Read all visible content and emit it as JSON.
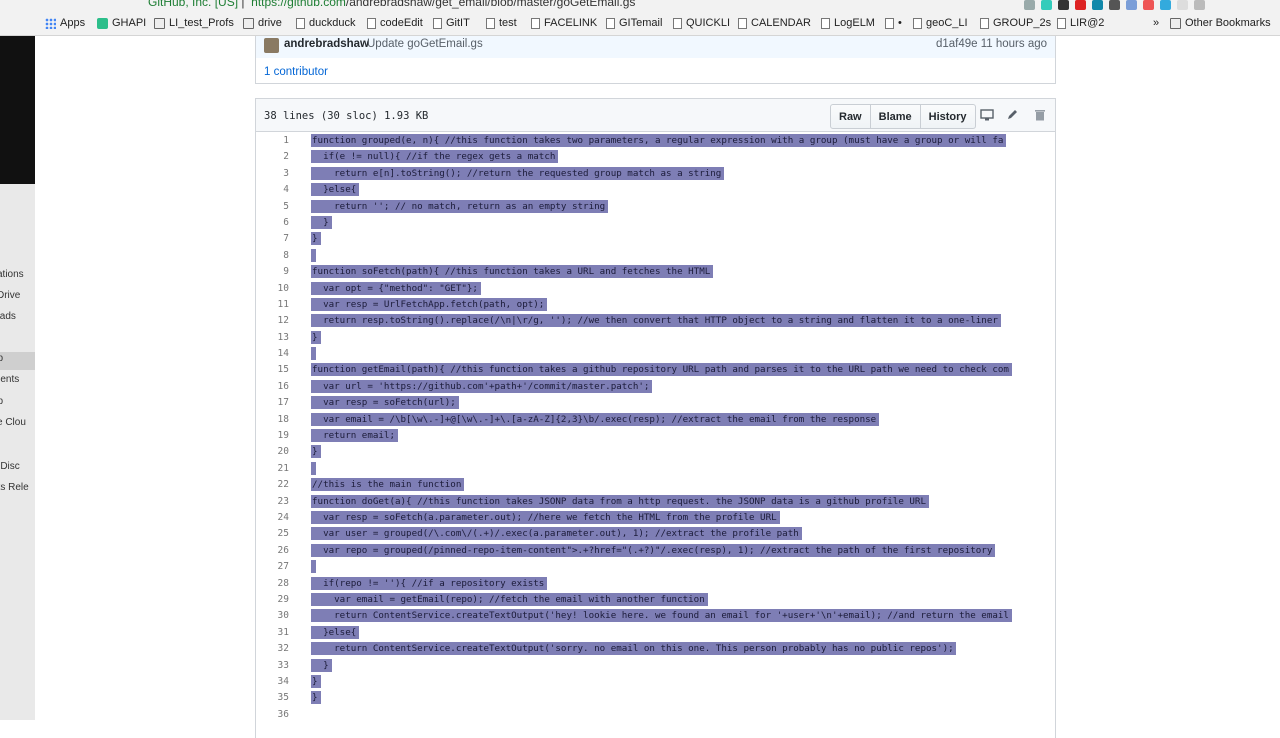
{
  "browser": {
    "url_secure": "GitHub, Inc. [US]",
    "url_host": "https://github.com",
    "url_path": "/andrebradshaw/get_email/blob/master/goGetEmail.gs"
  },
  "bookmarks": [
    {
      "label": "Apps",
      "icon": "apps-grid-icon"
    },
    {
      "label": "GHAPI",
      "icon": "ghapi-icon"
    },
    {
      "label": "LI_test_Profs",
      "icon": "folder-icon"
    },
    {
      "label": "drive",
      "icon": "folder-icon"
    },
    {
      "label": "duckduck",
      "icon": "page-icon"
    },
    {
      "label": "codeEdit",
      "icon": "page-icon"
    },
    {
      "label": "GitIT",
      "icon": "page-icon"
    },
    {
      "label": "test",
      "icon": "page-icon"
    },
    {
      "label": "FACELINK",
      "icon": "page-icon"
    },
    {
      "label": "GITemail",
      "icon": "page-icon"
    },
    {
      "label": "QUICKLI",
      "icon": "page-icon"
    },
    {
      "label": "CALENDAR",
      "icon": "page-icon"
    },
    {
      "label": "LogELM",
      "icon": "page-icon"
    },
    {
      "label": "•",
      "icon": "page-icon"
    },
    {
      "label": "geoC_LI",
      "icon": "page-icon"
    },
    {
      "label": "GROUP_2s",
      "icon": "page-icon"
    },
    {
      "label": "LIR@2",
      "icon": "page-icon"
    },
    {
      "label": "»",
      "icon": ""
    },
    {
      "label": "Other Bookmarks",
      "icon": "folder-icon"
    }
  ],
  "left_window": {
    "items": [
      "cations",
      "l Drive",
      "loads",
      "ts",
      "op",
      "ments",
      "op",
      "ve Clou",
      "e Disc",
      "ets Rele",
      "e"
    ]
  },
  "commit": {
    "author": "andrebradshaw",
    "message": "Update goGetEmail.gs",
    "sha_time": "d1af49e 11 hours ago",
    "contributors": "1 contributor"
  },
  "file": {
    "info": "38 lines (30 sloc)   1.93 KB",
    "buttons": {
      "raw": "Raw",
      "blame": "Blame",
      "history": "History"
    }
  },
  "code_lines": [
    "function grouped(e, n){ //this function takes two parameters, a regular expression with a group (must have a group or will fa",
    "  if(e != null){ //if the regex gets a match",
    "    return e[n].toString(); //return the requested group match as a string",
    "  }else{",
    "    return ''; // no match, return as an empty string",
    "  }",
    "}",
    "",
    "function soFetch(path){ //this function takes a URL and fetches the HTML",
    "  var opt = {\"method\": \"GET\"};",
    "  var resp = UrlFetchApp.fetch(path, opt);",
    "  return resp.toString().replace(/\\n|\\r/g, ''); //we then convert that HTTP object to a string and flatten it to a one-liner",
    "}",
    "",
    "function getEmail(path){ //this function takes a github repository URL path and parses it to the URL path we need to check com",
    "  var url = 'https://github.com'+path+'/commit/master.patch';",
    "  var resp = soFetch(url);",
    "  var email = /\\b[\\w\\.-]+@[\\w\\.-]+\\.[a-zA-Z]{2,3}\\b/.exec(resp); //extract the email from the response",
    "  return email;",
    "}",
    "",
    "//this is the main function",
    "function doGet(a){ //this function takes JSONP data from a http request. the JSONP data is a github profile URL",
    "  var resp = soFetch(a.parameter.out); //here we fetch the HTML from the profile URL",
    "  var user = grouped(/\\.com\\/(.+)/.exec(a.parameter.out), 1); //extract the profile path",
    "  var repo = grouped(/pinned-repo-item-content\">.+?href=\"(.+?)\"/.exec(resp), 1); //extract the path of the first repository",
    "",
    "  if(repo != ''){ //if a repository exists",
    "    var email = getEmail(repo); //fetch the email with another function",
    "    return ContentService.createTextOutput('hey! lookie here. we found an email for '+user+'\\n'+email); //and return the email",
    "  }else{",
    "    return ContentService.createTextOutput('sorry. no email on this one. This person probably has no public repos');",
    "  }",
    "}",
    "}",
    ""
  ]
}
